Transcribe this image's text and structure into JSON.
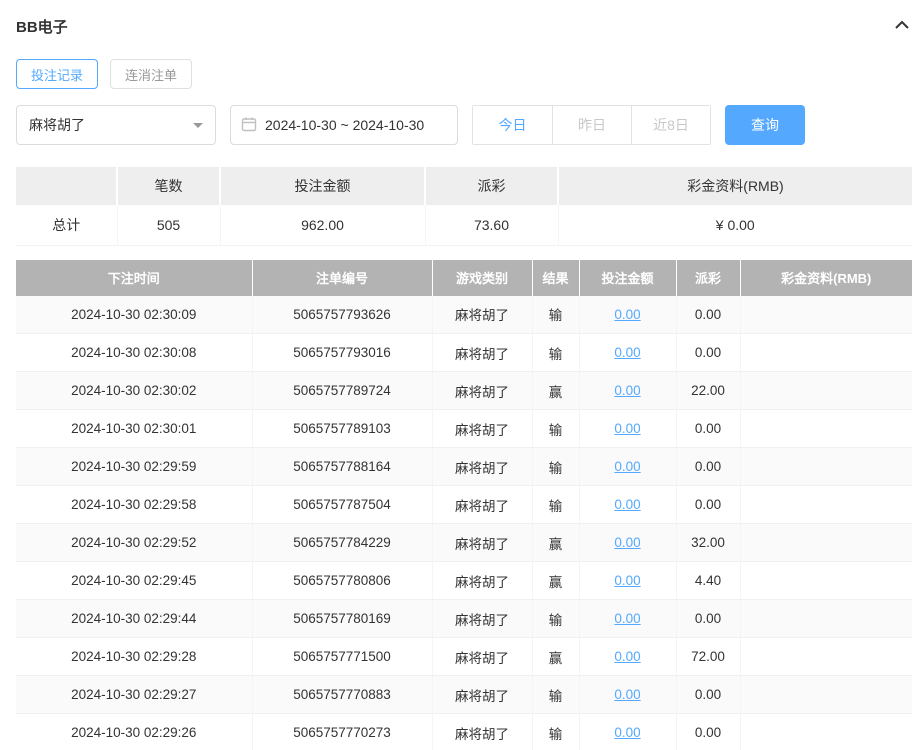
{
  "panel": {
    "title": "BB电子"
  },
  "tabs": [
    {
      "label": "投注记录",
      "active": true
    },
    {
      "label": "连消注单",
      "active": false
    }
  ],
  "filters": {
    "game_select_value": "麻将胡了",
    "date_range_value": "2024-10-30 ~ 2024-10-30",
    "quick_buttons": [
      {
        "label": "今日",
        "active": true
      },
      {
        "label": "昨日",
        "active": false
      },
      {
        "label": "近8日",
        "active": false
      }
    ],
    "search_label": "查询"
  },
  "summary": {
    "headers": [
      "笔数",
      "投注金额",
      "派彩",
      "彩金资料(RMB)"
    ],
    "row_label": "总计",
    "count": "505",
    "bet_total": "962.00",
    "payout_total": "73.60",
    "bonus_total": "¥ 0.00"
  },
  "table": {
    "headers": [
      "下注时间",
      "注单编号",
      "游戏类别",
      "结果",
      "投注金额",
      "派彩",
      "彩金资料(RMB)"
    ],
    "rows": [
      {
        "time": "2024-10-30 02:30:09",
        "order": "5065757793626",
        "game": "麻将胡了",
        "result": "输",
        "bet": "0.00",
        "payout": "0.00",
        "bonus": ""
      },
      {
        "time": "2024-10-30 02:30:08",
        "order": "5065757793016",
        "game": "麻将胡了",
        "result": "输",
        "bet": "0.00",
        "payout": "0.00",
        "bonus": ""
      },
      {
        "time": "2024-10-30 02:30:02",
        "order": "5065757789724",
        "game": "麻将胡了",
        "result": "赢",
        "bet": "0.00",
        "payout": "22.00",
        "bonus": ""
      },
      {
        "time": "2024-10-30 02:30:01",
        "order": "5065757789103",
        "game": "麻将胡了",
        "result": "输",
        "bet": "0.00",
        "payout": "0.00",
        "bonus": ""
      },
      {
        "time": "2024-10-30 02:29:59",
        "order": "5065757788164",
        "game": "麻将胡了",
        "result": "输",
        "bet": "0.00",
        "payout": "0.00",
        "bonus": ""
      },
      {
        "time": "2024-10-30 02:29:58",
        "order": "5065757787504",
        "game": "麻将胡了",
        "result": "输",
        "bet": "0.00",
        "payout": "0.00",
        "bonus": ""
      },
      {
        "time": "2024-10-30 02:29:52",
        "order": "5065757784229",
        "game": "麻将胡了",
        "result": "赢",
        "bet": "0.00",
        "payout": "32.00",
        "bonus": ""
      },
      {
        "time": "2024-10-30 02:29:45",
        "order": "5065757780806",
        "game": "麻将胡了",
        "result": "赢",
        "bet": "0.00",
        "payout": "4.40",
        "bonus": ""
      },
      {
        "time": "2024-10-30 02:29:44",
        "order": "5065757780169",
        "game": "麻将胡了",
        "result": "输",
        "bet": "0.00",
        "payout": "0.00",
        "bonus": ""
      },
      {
        "time": "2024-10-30 02:29:28",
        "order": "5065757771500",
        "game": "麻将胡了",
        "result": "赢",
        "bet": "0.00",
        "payout": "72.00",
        "bonus": ""
      },
      {
        "time": "2024-10-30 02:29:27",
        "order": "5065757770883",
        "game": "麻将胡了",
        "result": "输",
        "bet": "0.00",
        "payout": "0.00",
        "bonus": ""
      },
      {
        "time": "2024-10-30 02:29:26",
        "order": "5065757770273",
        "game": "麻将胡了",
        "result": "输",
        "bet": "0.00",
        "payout": "0.00",
        "bonus": ""
      }
    ]
  },
  "colors": {
    "accent": "#54a9ff",
    "table_header_bg": "#b3b3b3",
    "summary_header_bg": "#eeeeee"
  }
}
